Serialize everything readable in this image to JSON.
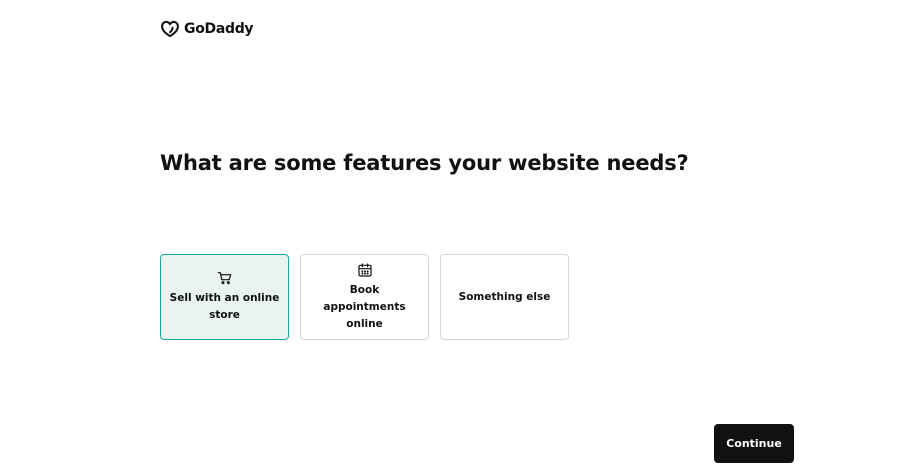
{
  "brand": {
    "name": "GoDaddy",
    "logo_icon": "godaddy-heart-logo",
    "colors": {
      "accent": "#1ba6a0",
      "selected_background": "#e8f3f2",
      "button": "#111111"
    }
  },
  "main": {
    "heading": "What are some features your website needs?",
    "options": [
      {
        "label": "Sell with an online store",
        "icon": "shopping-cart-icon",
        "selected": true
      },
      {
        "label": "Book appointments online",
        "icon": "calendar-icon",
        "selected": false
      },
      {
        "label": "Something else",
        "icon": "",
        "selected": false
      }
    ]
  },
  "footer": {
    "continue_label": "Continue"
  }
}
